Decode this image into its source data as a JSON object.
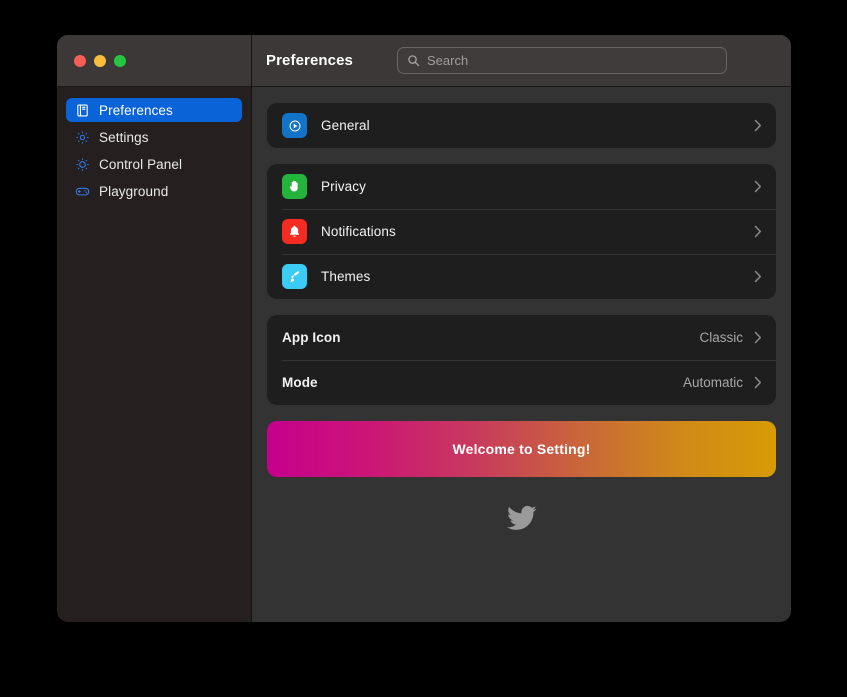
{
  "window": {
    "traffic_lights": [
      {
        "name": "close",
        "color": "#F65E57"
      },
      {
        "name": "minimize",
        "color": "#F8BD3F"
      },
      {
        "name": "maximize",
        "color": "#27C63F"
      }
    ]
  },
  "sidebar": {
    "items": [
      {
        "label": "Preferences",
        "icon": "book-icon",
        "selected": true
      },
      {
        "label": "Settings",
        "icon": "gear-icon",
        "selected": false
      },
      {
        "label": "Control Panel",
        "icon": "brightness-icon",
        "selected": false
      },
      {
        "label": "Playground",
        "icon": "gamepad-icon",
        "selected": false
      }
    ],
    "selected_color": "#0B63D8",
    "background": "#251F1F"
  },
  "header": {
    "title": "Preferences",
    "search": {
      "placeholder": "Search",
      "value": "",
      "icon": "search-icon"
    }
  },
  "main": {
    "background": "#333333",
    "card_background": "#1E1E1E",
    "groups": [
      {
        "name": "group-general",
        "rows": [
          {
            "label": "General",
            "icon": "gear-icon",
            "tile_color": "#1273C8",
            "accessory": "chevron-right-icon"
          }
        ]
      },
      {
        "name": "group-options",
        "rows": [
          {
            "label": "Privacy",
            "icon": "hand-raised-icon",
            "tile_color": "#24B33C",
            "accessory": "chevron-right-icon"
          },
          {
            "label": "Notifications",
            "icon": "bell-icon",
            "tile_color": "#F42B22",
            "accessory": "chevron-right-icon"
          },
          {
            "label": "Themes",
            "icon": "paintbrush-icon",
            "tile_color": "#3BCBF5",
            "accessory": "chevron-right-icon"
          }
        ]
      },
      {
        "name": "group-values",
        "rows": [
          {
            "label": "App Icon",
            "value": "Classic",
            "accessory": "chevron-right-icon"
          },
          {
            "label": "Mode",
            "value": "Automatic",
            "accessory": "chevron-right-icon"
          }
        ]
      }
    ],
    "banner": {
      "text": "Welcome to Setting!",
      "gradient_start": "#C5008D",
      "gradient_end": "#D79B06"
    },
    "footer": {
      "icon": "twitter-bird-icon",
      "color": "#9A9A9A"
    }
  }
}
